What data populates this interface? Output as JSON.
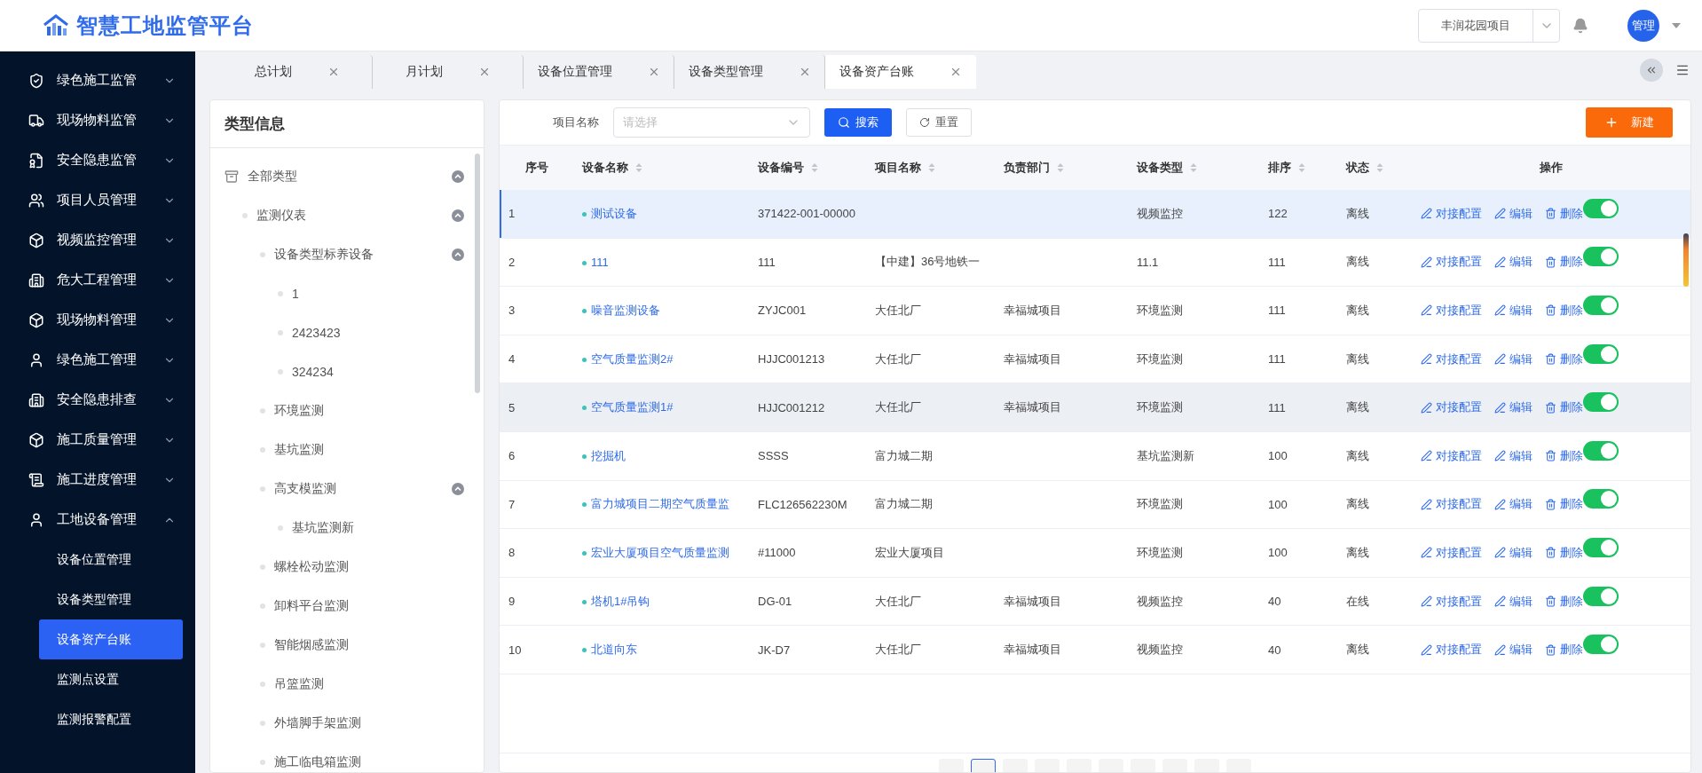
{
  "header": {
    "title": "智慧工地监管平台",
    "project": "丰润花园项目",
    "user": "管理"
  },
  "sidebar": {
    "items": [
      {
        "label": "绿色施工监管",
        "expanded": false
      },
      {
        "label": "现场物料监管",
        "expanded": false
      },
      {
        "label": "安全隐患监管",
        "expanded": false
      },
      {
        "label": "项目人员管理",
        "expanded": false
      },
      {
        "label": "视频监控管理",
        "expanded": false
      },
      {
        "label": "危大工程管理",
        "expanded": false
      },
      {
        "label": "现场物料管理",
        "expanded": false
      },
      {
        "label": "绿色施工管理",
        "expanded": false
      },
      {
        "label": "安全隐患排查",
        "expanded": false
      },
      {
        "label": "施工质量管理",
        "expanded": false
      },
      {
        "label": "施工进度管理",
        "expanded": false
      },
      {
        "label": "工地设备管理",
        "expanded": true,
        "children": [
          {
            "label": "设备位置管理",
            "selected": false
          },
          {
            "label": "设备类型管理",
            "selected": false
          },
          {
            "label": "设备资产台账",
            "selected": true
          },
          {
            "label": "监测点设置",
            "selected": false
          },
          {
            "label": "监测报警配置",
            "selected": false
          }
        ]
      }
    ]
  },
  "tabs": [
    {
      "label": "总计划",
      "selected": false
    },
    {
      "label": "月计划",
      "selected": false
    },
    {
      "label": "设备位置管理",
      "selected": false
    },
    {
      "label": "设备类型管理",
      "selected": false
    },
    {
      "label": "设备资产台账",
      "selected": true
    }
  ],
  "tree": {
    "title": "类型信息",
    "nodes": [
      {
        "label": "全部类型",
        "expanded": true,
        "children": [
          {
            "label": "监测仪表",
            "expanded": true,
            "children": [
              {
                "label": "设备类型标养设备",
                "expanded": true,
                "children": [
                  {
                    "label": "1"
                  },
                  {
                    "label": "2423423"
                  },
                  {
                    "label": "324234"
                  }
                ]
              },
              {
                "label": "环境监测"
              },
              {
                "label": "基坑监测"
              },
              {
                "label": "高支模监测",
                "expanded": true,
                "children": [
                  {
                    "label": "基坑监测新"
                  }
                ]
              },
              {
                "label": "螺栓松动监测"
              },
              {
                "label": "卸料平台监测"
              },
              {
                "label": "智能烟感监测"
              },
              {
                "label": "吊篮监测"
              },
              {
                "label": "外墙脚手架监测"
              },
              {
                "label": "施工临电箱监测"
              }
            ]
          }
        ]
      }
    ]
  },
  "filter": {
    "label": "项目名称",
    "placeholder": "请选择",
    "search": "搜索",
    "reset": "重置",
    "create": "新建"
  },
  "table": {
    "columns": [
      {
        "label": "序号",
        "sortable": false
      },
      {
        "label": "设备名称",
        "sortable": true
      },
      {
        "label": "设备编号",
        "sortable": true
      },
      {
        "label": "项目名称",
        "sortable": true
      },
      {
        "label": "负责部门",
        "sortable": true
      },
      {
        "label": "设备类型",
        "sortable": true
      },
      {
        "label": "排序",
        "sortable": true
      },
      {
        "label": "状态",
        "sortable": true
      },
      {
        "label": "操作",
        "sortable": false
      }
    ],
    "rows": [
      {
        "index": "1",
        "name": "测试设备",
        "code": "371422-001-00000",
        "type": "视频监控",
        "sort": "122",
        "status": "离线",
        "actions": [
          "对接配置",
          "编辑",
          "删除"
        ],
        "enabled": true,
        "selected": true,
        "hovered": false
      },
      {
        "index": "2",
        "name": "111",
        "code": "111",
        "project": "【中建】36号地铁一",
        "type": "11.1",
        "sort": "111",
        "status": "离线",
        "actions": [
          "对接配置",
          "编辑",
          "删除"
        ],
        "enabled": true,
        "selected": false,
        "hovered": false
      },
      {
        "index": "3",
        "name": "噪音监测设备",
        "code": "ZYJC001",
        "project": "大任北厂",
        "dept": "幸福城项目",
        "type": "环境监测",
        "sort": "111",
        "status": "离线",
        "actions": [
          "对接配置",
          "编辑",
          "删除"
        ],
        "enabled": true,
        "selected": false,
        "hovered": false
      },
      {
        "index": "4",
        "name": "空气质量监测2#",
        "code": "HJJC001213",
        "project": "大任北厂",
        "dept": "幸福城项目",
        "type": "环境监测",
        "sort": "111",
        "status": "离线",
        "actions": [
          "对接配置",
          "编辑",
          "删除"
        ],
        "enabled": true,
        "selected": false,
        "hovered": false
      },
      {
        "index": "5",
        "name": "空气质量监测1#",
        "code": "HJJC001212",
        "project": "大任北厂",
        "dept": "幸福城项目",
        "type": "环境监测",
        "sort": "111",
        "status": "离线",
        "actions": [
          "对接配置",
          "编辑",
          "删除"
        ],
        "enabled": true,
        "selected": false,
        "hovered": true
      },
      {
        "index": "6",
        "name": "挖掘机",
        "code": "SSSS",
        "project": "富力城二期",
        "type": "基坑监测新",
        "sort": "100",
        "status": "离线",
        "actions": [
          "对接配置",
          "编辑",
          "删除"
        ],
        "enabled": true,
        "selected": false,
        "hovered": false
      },
      {
        "index": "7",
        "name": "富力城项目二期空气质量监",
        "code": "FLC126562230M",
        "project": "富力城二期",
        "type": "环境监测",
        "sort": "100",
        "status": "离线",
        "actions": [
          "对接配置",
          "编辑",
          "删除"
        ],
        "enabled": true,
        "selected": false,
        "hovered": false
      },
      {
        "index": "8",
        "name": "宏业大厦项目空气质量监测",
        "code": "#11000",
        "project": "宏业大厦项目",
        "type": "环境监测",
        "sort": "100",
        "status": "离线",
        "actions": [
          "对接配置",
          "编辑",
          "删除"
        ],
        "enabled": true,
        "selected": false,
        "hovered": false
      },
      {
        "index": "9",
        "name": "塔机1#吊钩",
        "code": "DG-01",
        "project": "大任北厂",
        "dept": "幸福城项目",
        "type": "视频监控",
        "sort": "40",
        "status": "在线",
        "actions": [
          "对接配置",
          "编辑",
          "删除"
        ],
        "enabled": true,
        "selected": false,
        "hovered": false
      },
      {
        "index": "10",
        "name": "北道向东",
        "code": "JK-D7",
        "project": "大任北厂",
        "dept": "幸福城项目",
        "type": "视频监控",
        "sort": "40",
        "status": "离线",
        "actions": [
          "对接配置",
          "编辑",
          "删除"
        ],
        "enabled": true,
        "selected": false,
        "hovered": false
      }
    ]
  },
  "pagination": {
    "pages": [
      {
        "selected": false
      },
      {
        "selected": true
      },
      {
        "selected": false
      },
      {
        "selected": false
      },
      {
        "selected": false
      },
      {
        "selected": false
      },
      {
        "selected": false
      },
      {
        "selected": false
      },
      {
        "selected": false
      },
      {
        "selected": false
      }
    ]
  }
}
